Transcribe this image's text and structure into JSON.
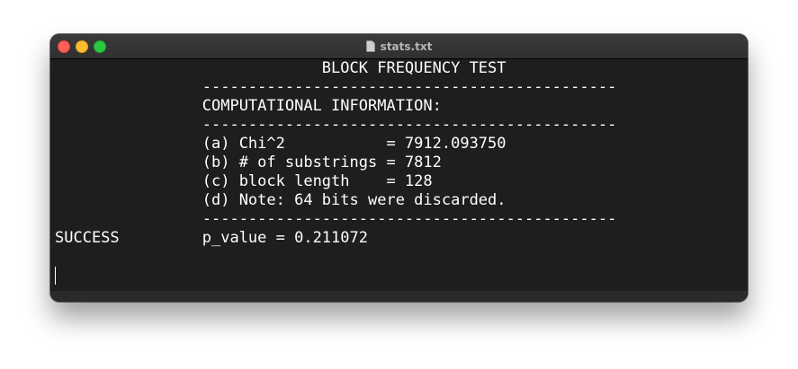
{
  "window": {
    "title": "stats.txt",
    "buttons": [
      "close",
      "minimize",
      "zoom"
    ],
    "colors": {
      "close": "#fe5f57",
      "minimize": "#febc2e",
      "zoom": "#28c840",
      "background": "#1e1e1e"
    }
  },
  "terminal": {
    "lines": [
      "                             BLOCK FREQUENCY TEST",
      "                ---------------------------------------------",
      "                COMPUTATIONAL INFORMATION:",
      "                ---------------------------------------------",
      "                (a) Chi^2           = 7912.093750",
      "                (b) # of substrings = 7812",
      "                (c) block length    = 128",
      "                (d) Note: 64 bits were discarded.",
      "                ---------------------------------------------",
      "SUCCESS         p_value = 0.211072"
    ]
  }
}
